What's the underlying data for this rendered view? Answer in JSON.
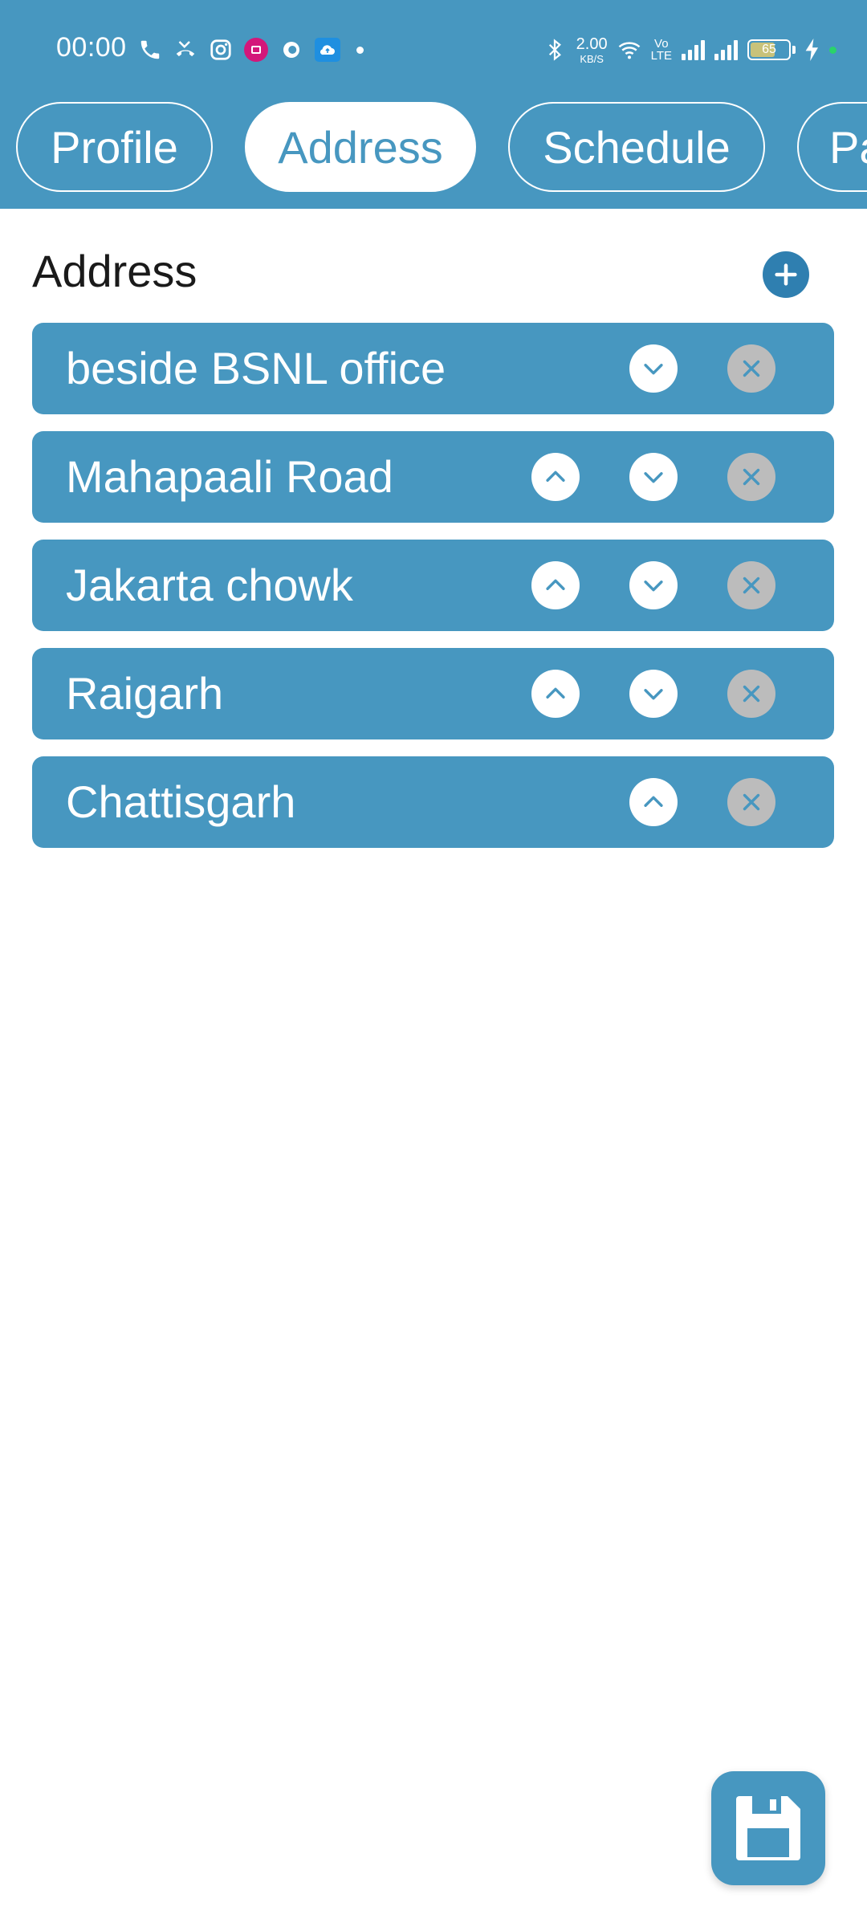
{
  "status_bar": {
    "time": "00:00",
    "speed_value": "2.00",
    "speed_unit": "KB/S",
    "volte_top": "Vo",
    "volte_bottom": "LTE",
    "battery": "65",
    "battery_level": 0.65,
    "icons_left": [
      "phone-icon",
      "missed-call-icon",
      "instagram-icon",
      "app-icon",
      "browser-icon",
      "cloud-icon",
      "dot-icon"
    ],
    "icons_right": [
      "bluetooth-icon",
      "wifi-icon",
      "volte-icon",
      "signal-icon",
      "signal-icon",
      "battery-icon",
      "charging-icon"
    ]
  },
  "tabs": [
    {
      "label": "Profile",
      "active": false
    },
    {
      "label": "Address",
      "active": true
    },
    {
      "label": "Schedule",
      "active": false
    },
    {
      "label": "Pa",
      "active": false
    }
  ],
  "section": {
    "title": "Address",
    "add_icon": "plus-icon"
  },
  "addresses": [
    {
      "text": "beside BSNL office",
      "controls": [
        "down",
        "delete"
      ]
    },
    {
      "text": "Mahapaali Road",
      "controls": [
        "up",
        "down",
        "delete"
      ]
    },
    {
      "text": "Jakarta chowk",
      "controls": [
        "up",
        "down",
        "delete"
      ]
    },
    {
      "text": "Raigarh",
      "controls": [
        "up",
        "down",
        "delete"
      ]
    },
    {
      "text": "Chattisgarh",
      "controls": [
        "up",
        "delete"
      ]
    }
  ],
  "fab": {
    "icon": "save-icon"
  },
  "colors": {
    "primary": "#4797c0",
    "primary_dark": "#2f7fb0",
    "delete_bg": "#bcbcbc",
    "text_dark": "#1a1a1a",
    "white": "#ffffff"
  }
}
